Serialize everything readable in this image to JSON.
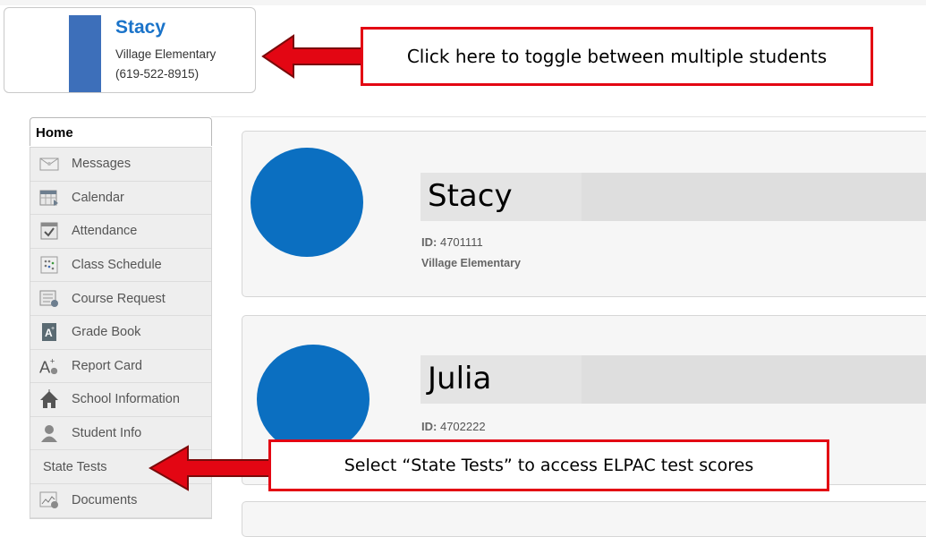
{
  "student_switcher": {
    "name": "Stacy",
    "school": "Village Elementary",
    "phone": "(619-522-8915)"
  },
  "callouts": {
    "toggle": "Click here to toggle between multiple students",
    "state_tests": "Select “State Tests” to access ELPAC test scores"
  },
  "sidebar": {
    "home": "Home",
    "items": [
      {
        "label": "Messages",
        "icon": "envelope-icon"
      },
      {
        "label": "Calendar",
        "icon": "calendar-icon"
      },
      {
        "label": "Attendance",
        "icon": "attendance-checkbox-icon"
      },
      {
        "label": "Class Schedule",
        "icon": "schedule-grid-icon"
      },
      {
        "label": "Course Request",
        "icon": "course-request-icon"
      },
      {
        "label": "Grade Book",
        "icon": "grade-book-icon"
      },
      {
        "label": "Report Card",
        "icon": "report-card-icon"
      },
      {
        "label": "School Information",
        "icon": "school-icon"
      },
      {
        "label": "Student Info",
        "icon": "student-icon"
      },
      {
        "label": "State Tests",
        "icon": ""
      },
      {
        "label": "Documents",
        "icon": "documents-icon"
      }
    ]
  },
  "students": [
    {
      "name": "Stacy",
      "id_label": "ID:",
      "id": "4701111",
      "school": "Village Elementary"
    },
    {
      "name": "Julia",
      "id_label": "ID:",
      "id": "4702222"
    }
  ],
  "colors": {
    "accent_blue": "#1a73c9",
    "photo_blue": "#0b6fc1",
    "callout_red": "#e30613"
  }
}
